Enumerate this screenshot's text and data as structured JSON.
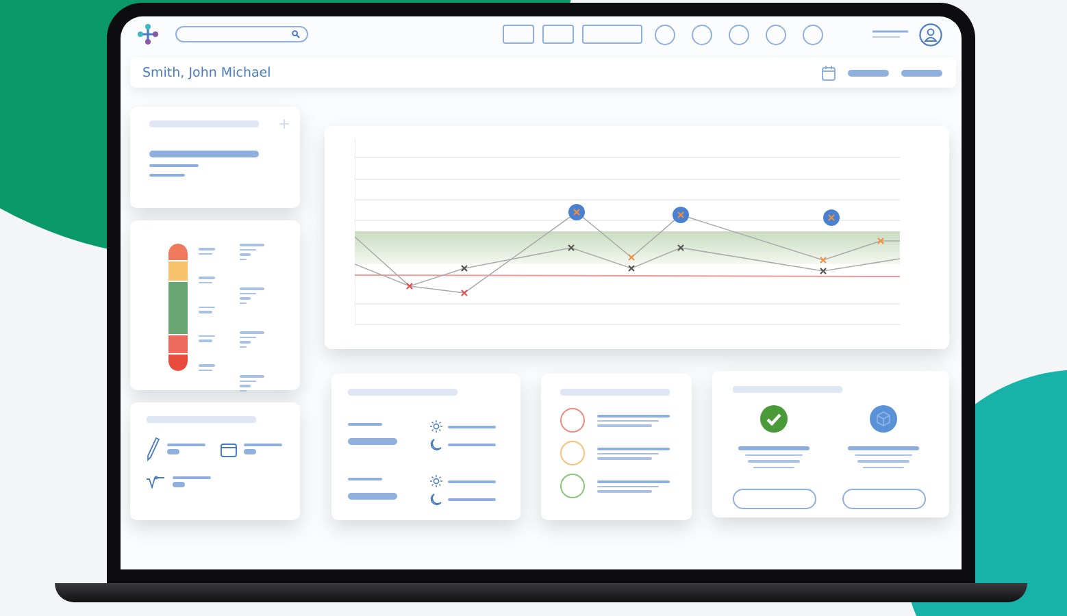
{
  "header": {
    "patient_name": "Smith, John Michael"
  },
  "gauge": {
    "segments": [
      {
        "color": "#ef7a5e"
      },
      {
        "color": "#f7c06a"
      },
      {
        "color": "#6aa574"
      },
      {
        "color": "#ec6a5e"
      },
      {
        "color": "#e84c3d"
      }
    ]
  },
  "status_list": [
    {
      "color": "#ef8a80"
    },
    {
      "color": "#f7c27a"
    },
    {
      "color": "#8cc47a"
    }
  ]
}
